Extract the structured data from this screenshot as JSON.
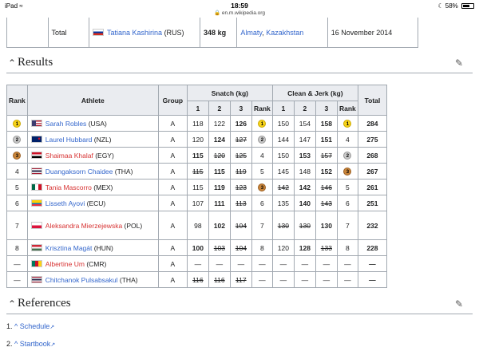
{
  "status_bar": {
    "device": "iPad",
    "time": "18:59",
    "url": "en.m.wikipedia.org",
    "battery": "58%"
  },
  "record_row": {
    "label": "Total",
    "athlete": "Tatiana Kashirina",
    "country_code": "(RUS)",
    "value": "348 kg",
    "city": "Almaty",
    "country": "Kazakhstan",
    "date": "16 November 2014",
    "flag": "RUS"
  },
  "results": {
    "heading": "Results",
    "headers": {
      "rank": "Rank",
      "athlete": "Athlete",
      "group": "Group",
      "snatch": "Snatch (kg)",
      "cj": "Clean & Jerk (kg)",
      "total": "Total",
      "a1": "1",
      "a2": "2",
      "a3": "3",
      "arank": "Rank"
    },
    "rows": [
      {
        "rank": "1",
        "medal": "gold",
        "name": "Sarah Robles",
        "cc": "(USA)",
        "flag": "USA",
        "red": false,
        "group": "A",
        "sn": [
          "118",
          "122",
          "126"
        ],
        "sn_fail": [
          false,
          false,
          false
        ],
        "sn_best": 2,
        "sn_rank": "1",
        "sn_medal": "gold",
        "cj": [
          "150",
          "154",
          "158"
        ],
        "cj_fail": [
          false,
          false,
          false
        ],
        "cj_best": 2,
        "cj_rank": "1",
        "cj_medal": "gold",
        "total": "284"
      },
      {
        "rank": "2",
        "medal": "silver",
        "name": "Laurel Hubbard",
        "cc": "(NZL)",
        "flag": "NZL",
        "red": false,
        "group": "A",
        "sn": [
          "120",
          "124",
          "127"
        ],
        "sn_fail": [
          false,
          false,
          true
        ],
        "sn_best": 1,
        "sn_rank": "2",
        "sn_medal": "silver",
        "cj": [
          "144",
          "147",
          "151"
        ],
        "cj_fail": [
          false,
          false,
          false
        ],
        "cj_best": 2,
        "cj_rank": "4",
        "cj_medal": "",
        "total": "275"
      },
      {
        "rank": "3",
        "medal": "bronze",
        "name": "Shaimaa Khalaf",
        "cc": "(EGY)",
        "flag": "EGY",
        "red": true,
        "group": "A",
        "sn": [
          "115",
          "120",
          "125"
        ],
        "sn_fail": [
          false,
          true,
          true
        ],
        "sn_best": 0,
        "sn_rank": "4",
        "sn_medal": "",
        "cj": [
          "150",
          "153",
          "157"
        ],
        "cj_fail": [
          false,
          false,
          true
        ],
        "cj_best": 1,
        "cj_rank": "2",
        "cj_medal": "silver",
        "total": "268"
      },
      {
        "rank": "4",
        "medal": "",
        "name": "Duangaksorn Chaidee",
        "cc": "(THA)",
        "flag": "THA",
        "red": false,
        "group": "A",
        "sn": [
          "115",
          "115",
          "119"
        ],
        "sn_fail": [
          true,
          false,
          true
        ],
        "sn_best": 1,
        "sn_rank": "5",
        "sn_medal": "",
        "cj": [
          "145",
          "148",
          "152"
        ],
        "cj_fail": [
          false,
          false,
          false
        ],
        "cj_best": 2,
        "cj_rank": "3",
        "cj_medal": "bronze",
        "total": "267"
      },
      {
        "rank": "5",
        "medal": "",
        "name": "Tania Mascorro",
        "cc": "(MEX)",
        "flag": "MEX",
        "red": true,
        "group": "A",
        "sn": [
          "115",
          "119",
          "123"
        ],
        "sn_fail": [
          false,
          false,
          true
        ],
        "sn_best": 1,
        "sn_rank": "3",
        "sn_medal": "bronze",
        "cj": [
          "142",
          "142",
          "146"
        ],
        "cj_fail": [
          true,
          false,
          true
        ],
        "cj_best": 1,
        "cj_rank": "5",
        "cj_medal": "",
        "total": "261"
      },
      {
        "rank": "6",
        "medal": "",
        "name": "Lisseth Ayovi",
        "cc": "(ECU)",
        "flag": "ECU",
        "red": false,
        "group": "A",
        "sn": [
          "107",
          "111",
          "113"
        ],
        "sn_fail": [
          false,
          false,
          true
        ],
        "sn_best": 1,
        "sn_rank": "6",
        "sn_medal": "",
        "cj": [
          "135",
          "140",
          "143"
        ],
        "cj_fail": [
          false,
          false,
          true
        ],
        "cj_best": 1,
        "cj_rank": "6",
        "cj_medal": "",
        "total": "251"
      },
      {
        "rank": "7",
        "medal": "",
        "name": "Aleksandra Mierzejewska",
        "cc": "(POL)",
        "flag": "POL",
        "red": true,
        "group": "A",
        "tall": true,
        "sn": [
          "98",
          "102",
          "104"
        ],
        "sn_fail": [
          false,
          false,
          true
        ],
        "sn_best": 1,
        "sn_rank": "7",
        "sn_medal": "",
        "cj": [
          "130",
          "130",
          "130"
        ],
        "cj_fail": [
          true,
          true,
          false
        ],
        "cj_best": 2,
        "cj_rank": "7",
        "cj_medal": "",
        "total": "232"
      },
      {
        "rank": "8",
        "medal": "",
        "name": "Krisztina Magát",
        "cc": "(HUN)",
        "flag": "HUN",
        "red": false,
        "group": "A",
        "sn": [
          "100",
          "103",
          "104"
        ],
        "sn_fail": [
          false,
          true,
          true
        ],
        "sn_best": 0,
        "sn_rank": "8",
        "sn_medal": "",
        "cj": [
          "120",
          "128",
          "133"
        ],
        "cj_fail": [
          false,
          false,
          true
        ],
        "cj_best": 1,
        "cj_rank": "8",
        "cj_medal": "",
        "total": "228"
      },
      {
        "rank": "—",
        "medal": "",
        "name": "Albertine Um",
        "cc": "(CMR)",
        "flag": "CMR",
        "red": true,
        "group": "A",
        "sn": [
          "—",
          "—",
          "—"
        ],
        "sn_fail": [
          false,
          false,
          false
        ],
        "sn_best": -1,
        "sn_rank": "—",
        "sn_medal": "",
        "cj": [
          "—",
          "—",
          "—"
        ],
        "cj_fail": [
          false,
          false,
          false
        ],
        "cj_best": -1,
        "cj_rank": "—",
        "cj_medal": "",
        "total": "—"
      },
      {
        "rank": "—",
        "medal": "",
        "name": "Chitchanok Pulsabsakul",
        "cc": "(THA)",
        "flag": "THA",
        "red": false,
        "group": "A",
        "sn": [
          "116",
          "116",
          "117"
        ],
        "sn_fail": [
          true,
          true,
          true
        ],
        "sn_best": -1,
        "sn_rank": "—",
        "sn_medal": "",
        "cj": [
          "—",
          "—",
          "—"
        ],
        "cj_fail": [
          false,
          false,
          false
        ],
        "cj_best": -1,
        "cj_rank": "—",
        "cj_medal": "",
        "total": "—"
      }
    ]
  },
  "references": {
    "heading": "References",
    "items": [
      {
        "num": "1.",
        "caret": "^",
        "label": "Schedule"
      },
      {
        "num": "2.",
        "caret": "^",
        "label": "Startbook"
      }
    ]
  },
  "colors": {
    "link": "#3366cc",
    "redlink": "#d73333",
    "header_bg": "#eaecf0",
    "border": "#a2a9b1"
  }
}
